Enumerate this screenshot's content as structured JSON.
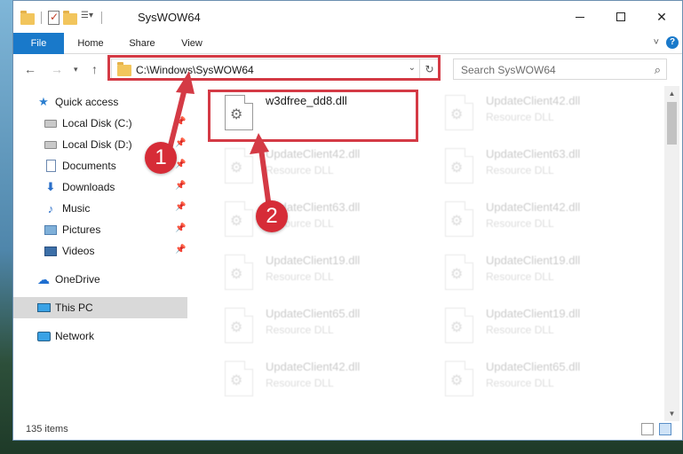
{
  "window": {
    "title": "SysWOW64",
    "controls": {
      "minimize": "minimize",
      "maximize": "maximize",
      "close": "✕"
    }
  },
  "ribbon": {
    "tabs": [
      {
        "label": "File"
      },
      {
        "label": "Home"
      },
      {
        "label": "Share"
      },
      {
        "label": "View"
      }
    ],
    "expand_icon": "˅",
    "help_icon": "?"
  },
  "navigation": {
    "back": "←",
    "forward": "→",
    "recent": "▾",
    "up": "↑"
  },
  "address_bar": {
    "path": "C:\\Windows\\SysWOW64",
    "dropdown": "⌄",
    "refresh": "↻"
  },
  "search": {
    "placeholder": "Search SysWOW64",
    "icon": "⌕"
  },
  "sidebar": {
    "items": [
      {
        "label": "Quick access",
        "icon": "star-icon",
        "pinned": false
      },
      {
        "label": "Local Disk (C:)",
        "icon": "disk-icon",
        "pinned": true
      },
      {
        "label": "Local Disk (D:)",
        "icon": "disk-icon",
        "pinned": true
      },
      {
        "label": "Documents",
        "icon": "documents-icon",
        "pinned": true
      },
      {
        "label": "Downloads",
        "icon": "download-icon",
        "pinned": true
      },
      {
        "label": "Music",
        "icon": "music-icon",
        "pinned": true
      },
      {
        "label": "Pictures",
        "icon": "pictures-icon",
        "pinned": true
      },
      {
        "label": "Videos",
        "icon": "videos-icon",
        "pinned": true
      },
      {
        "label": "OneDrive",
        "icon": "onedrive-icon",
        "pinned": false
      },
      {
        "label": "This PC",
        "icon": "this-pc-icon",
        "pinned": false,
        "selected": true
      },
      {
        "label": "Network",
        "icon": "network-icon",
        "pinned": false
      }
    ],
    "pin_glyph": "📌"
  },
  "files": {
    "left_column": [
      {
        "name": "w3dfree_dd8.dll",
        "type": "",
        "highlighted": true
      },
      {
        "name": "UpdateClient42.dll",
        "type": "Resource DLL"
      },
      {
        "name": "UpdateClient63.dll",
        "type": "Resource DLL"
      },
      {
        "name": "UpdateClient19.dll",
        "type": "Resource DLL"
      },
      {
        "name": "UpdateClient65.dll",
        "type": "Resource DLL"
      },
      {
        "name": "UpdateClient42.dll",
        "type": "Resource DLL"
      }
    ],
    "right_column": [
      {
        "name": "UpdateClient42.dll",
        "type": "Resource DLL"
      },
      {
        "name": "UpdateClient63.dll",
        "type": "Resource DLL"
      },
      {
        "name": "UpdateClient42.dll",
        "type": "Resource DLL"
      },
      {
        "name": "UpdateClient19.dll",
        "type": "Resource DLL"
      },
      {
        "name": "UpdateClient19.dll",
        "type": "Resource DLL"
      },
      {
        "name": "UpdateClient65.dll",
        "type": "Resource DLL"
      }
    ]
  },
  "status_bar": {
    "item_count": "135 items"
  },
  "annotations": {
    "badges": [
      {
        "label": "1"
      },
      {
        "label": "2"
      }
    ],
    "color": "#d43a45"
  }
}
